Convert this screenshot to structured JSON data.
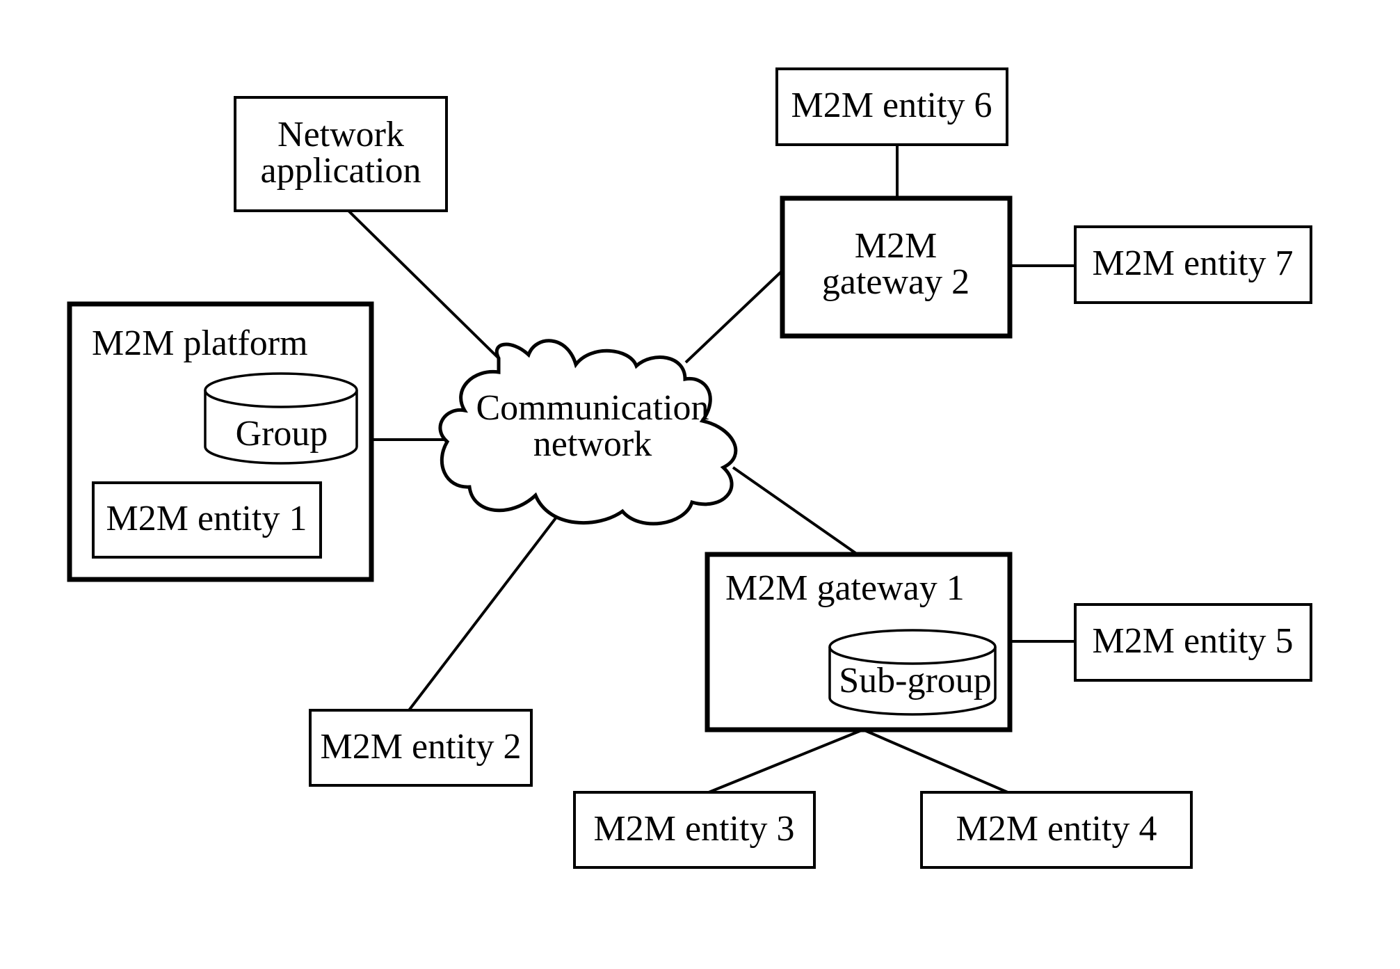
{
  "diagram": {
    "type": "network topology",
    "colors": {
      "stroke": "#000000",
      "background": "#ffffff"
    },
    "cloud": {
      "lines": [
        "Communication",
        "network"
      ]
    },
    "network_application": {
      "lines": [
        "Network",
        "application"
      ]
    },
    "platform": {
      "title": "M2M platform",
      "group_label": "Group",
      "entity_label": "M2M entity 1"
    },
    "gateway1": {
      "title": "M2M gateway 1",
      "subgroup_label": "Sub-group"
    },
    "gateway2": {
      "lines": [
        "M2M",
        "gateway 2"
      ]
    },
    "entities": {
      "e2": "M2M entity 2",
      "e3": "M2M entity 3",
      "e4": "M2M entity 4",
      "e5": "M2M entity 5",
      "e6": "M2M entity 6",
      "e7": "M2M entity 7"
    },
    "connections": [
      [
        "Network application",
        "Communication network"
      ],
      [
        "M2M platform",
        "Communication network"
      ],
      [
        "M2M gateway 2",
        "Communication network"
      ],
      [
        "M2M entity 2",
        "Communication network"
      ],
      [
        "M2M gateway 1",
        "Communication network"
      ],
      [
        "M2M entity 6",
        "M2M gateway 2"
      ],
      [
        "M2M entity 7",
        "M2M gateway 2"
      ],
      [
        "M2M entity 5",
        "M2M gateway 1"
      ],
      [
        "M2M entity 3",
        "M2M gateway 1"
      ],
      [
        "M2M entity 4",
        "M2M gateway 1"
      ]
    ]
  }
}
